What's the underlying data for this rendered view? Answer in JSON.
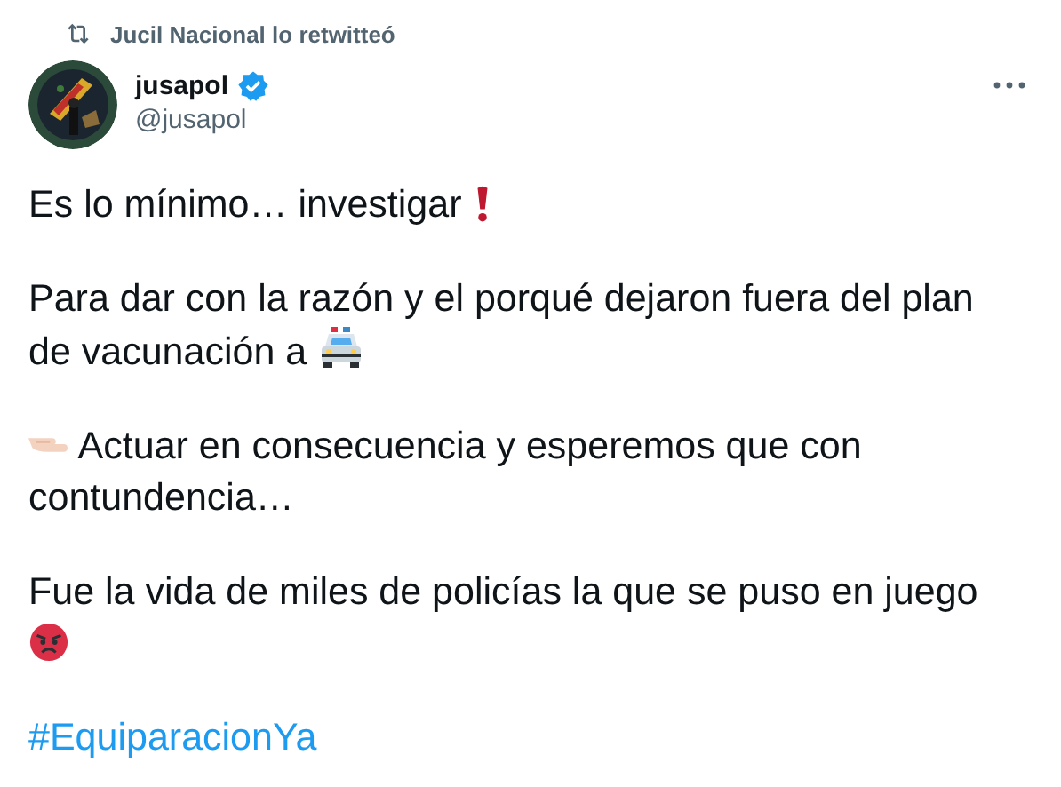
{
  "retweet_banner": {
    "text": "Jucil Nacional lo retwitteó"
  },
  "author": {
    "name": "jusapol",
    "verified": true,
    "handle": "@jusapol"
  },
  "paragraphs": [
    {
      "lines": [
        "Es lo mínimo… investigar"
      ]
    },
    {
      "lines": [
        "Para dar con la razón y el porqué dejaron fuera del plan",
        "de vacunación a"
      ]
    },
    {
      "lines": [
        "Actuar en consecuencia y esperemos que con",
        "contundencia…"
      ]
    },
    {
      "lines": [
        "Fue la vida de miles de policías la que se puso en juego"
      ]
    }
  ],
  "hashtag": "#EquiparacionYa"
}
